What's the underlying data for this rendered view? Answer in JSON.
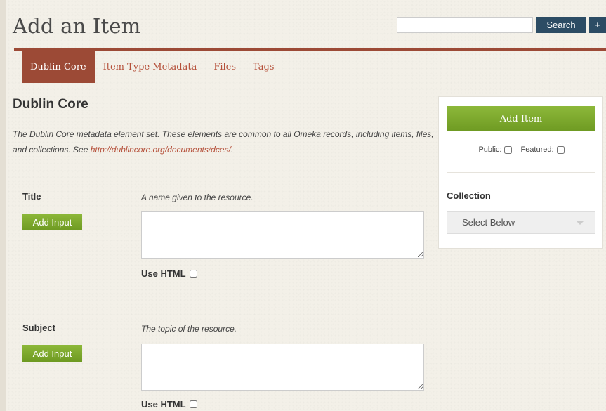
{
  "header": {
    "title": "Add an Item",
    "search": {
      "value": "",
      "button_label": "Search",
      "advanced_label": "+"
    }
  },
  "tabs": [
    {
      "label": "Dublin Core",
      "active": true
    },
    {
      "label": "Item Type Metadata",
      "active": false
    },
    {
      "label": "Files",
      "active": false
    },
    {
      "label": "Tags",
      "active": false
    }
  ],
  "main": {
    "section_title": "Dublin Core",
    "intro_text": "The Dublin Core metadata element set. These elements are common to all Omeka records, including items, files, and collections. See ",
    "intro_link": "http://dublincore.org/documents/dces/",
    "intro_end": ".",
    "fields": [
      {
        "label": "Title",
        "description": "A name given to the resource.",
        "add_label": "Add Input",
        "value": "",
        "use_html_label": "Use HTML",
        "use_html_checked": false
      },
      {
        "label": "Subject",
        "description": "The topic of the resource.",
        "add_label": "Add Input",
        "value": "",
        "use_html_label": "Use HTML",
        "use_html_checked": false
      }
    ]
  },
  "sidebar": {
    "add_item_label": "Add Item",
    "public_label": "Public:",
    "public_checked": false,
    "featured_label": "Featured:",
    "featured_checked": false,
    "collection_label": "Collection",
    "collection_selected": "Select Below"
  },
  "colors": {
    "accent": "#9c4a36",
    "link": "#b5503a",
    "button_green": "#7aa52a",
    "search_button": "#2c4c64",
    "background": "#f3f0e8"
  },
  "icons": {
    "collection_dropdown": "chevron-down-icon"
  }
}
